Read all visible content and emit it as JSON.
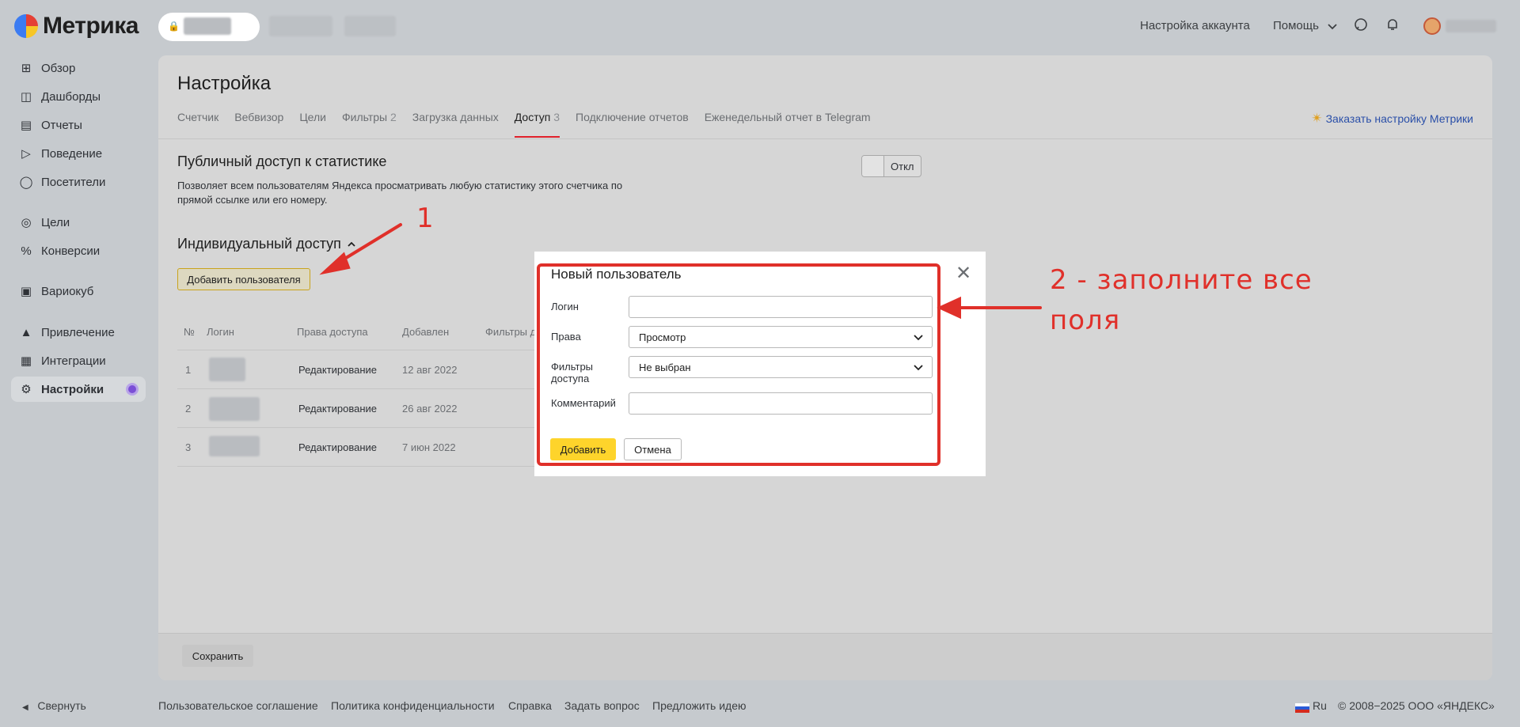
{
  "app": {
    "name": "Метрика"
  },
  "header": {
    "account_settings": "Настройка аккаунта",
    "help": "Помощь"
  },
  "sidebar": {
    "items": [
      {
        "label": "Обзор",
        "icon": "grid-icon"
      },
      {
        "label": "Дашборды",
        "icon": "dashboard-icon"
      },
      {
        "label": "Отчеты",
        "icon": "bar-chart-icon"
      },
      {
        "label": "Поведение",
        "icon": "play-icon"
      },
      {
        "label": "Посетители",
        "icon": "person-icon"
      },
      {
        "label": "Цели",
        "icon": "target-icon"
      },
      {
        "label": "Конверсии",
        "icon": "percent-icon"
      },
      {
        "label": "Вариокуб",
        "icon": "cube-icon"
      },
      {
        "label": "Привлечение",
        "icon": "flame-icon"
      },
      {
        "label": "Интеграции",
        "icon": "integration-icon"
      },
      {
        "label": "Настройки",
        "icon": "gear-icon"
      }
    ],
    "collapse": "Свернуть"
  },
  "page": {
    "title": "Настройка",
    "tabs": [
      {
        "label": "Счетчик",
        "count": ""
      },
      {
        "label": "Вебвизор",
        "count": ""
      },
      {
        "label": "Цели",
        "count": ""
      },
      {
        "label": "Фильтры",
        "count": "2"
      },
      {
        "label": "Загрузка данных",
        "count": ""
      },
      {
        "label": "Доступ",
        "count": "3"
      },
      {
        "label": "Подключение отчетов",
        "count": ""
      },
      {
        "label": "Еженедельный отчет в Telegram",
        "count": ""
      }
    ],
    "order_link": "Заказать настройку Метрики",
    "public_access": {
      "title": "Публичный доступ к статистике",
      "description": "Позволяет всем пользователям Яндекса просматривать любую статистику этого счетчика по прямой ссылке или его номеру.",
      "toggle_label": "Откл"
    },
    "individual_access": {
      "title": "Индивидуальный доступ",
      "add_user": "Добавить пользователя"
    },
    "table": {
      "headers": [
        "№",
        "Логин",
        "Права доступа",
        "Добавлен",
        "Фильтры д"
      ],
      "rows": [
        {
          "num": "1",
          "rights": "Редактирование",
          "added": "12 авг 2022"
        },
        {
          "num": "2",
          "rights": "Редактирование",
          "added": "26 авг 2022"
        },
        {
          "num": "3",
          "rights": "Редактирование",
          "added": "7 июн 2022"
        }
      ]
    },
    "save": "Сохранить"
  },
  "modal": {
    "title": "Новый пользователь",
    "fields": {
      "login_label": "Логин",
      "login_value": "",
      "rights_label": "Права",
      "rights_value": "Просмотр",
      "filters_label_1": "Фильтры",
      "filters_label_2": "доступа",
      "filters_value": "Не выбран",
      "comment_label": "Комментарий",
      "comment_value": ""
    },
    "add": "Добавить",
    "cancel": "Отмена"
  },
  "annotations": {
    "one": "1",
    "two_line1": "2 - заполните все",
    "two_line2": "поля",
    "color": "#e0302a"
  },
  "footer": {
    "links": [
      "Пользовательское соглашение",
      "Политика конфиденциальности",
      "Справка",
      "Задать вопрос",
      "Предложить идею"
    ],
    "lang": "Ru",
    "copyright": "© 2008−2025 ООО «ЯНДЕКС»"
  }
}
